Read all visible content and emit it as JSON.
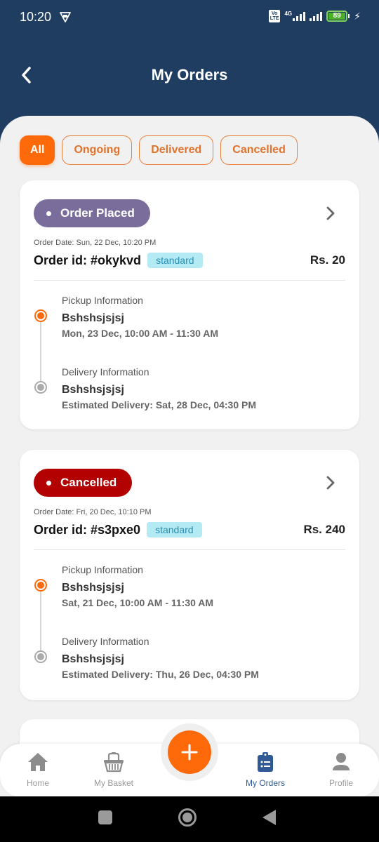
{
  "status_bar": {
    "time": "10:20",
    "network_label": "4G",
    "volte_label": "Vo LTE",
    "battery_percent": "89",
    "icons": [
      "vpn-icon",
      "volte-icon",
      "signal-icon",
      "signal-icon",
      "battery-icon",
      "charging-icon"
    ]
  },
  "header": {
    "title": "My Orders",
    "back_icon": "chevron-left-icon"
  },
  "filters": [
    {
      "label": "All",
      "active": true
    },
    {
      "label": "Ongoing",
      "active": false
    },
    {
      "label": "Delivered",
      "active": false
    },
    {
      "label": "Cancelled",
      "active": false
    }
  ],
  "orders": [
    {
      "status": "Order Placed",
      "status_color": "#7b6d9b",
      "order_date": "Order Date: Sun, 22 Dec, 10:20 PM",
      "order_id": "Order id: #okykvd",
      "tag": "standard",
      "price": "Rs. 20",
      "pickup": {
        "heading": "Pickup Information",
        "name": "Bshshsjsjsj",
        "time": "Mon, 23 Dec, 10:00 AM - 11:30 AM"
      },
      "delivery": {
        "heading": "Delivery Information",
        "name": "Bshshsjsjsj",
        "time": "Estimated Delivery: Sat, 28 Dec, 04:30 PM"
      }
    },
    {
      "status": "Cancelled",
      "status_color": "#b30000",
      "order_date": "Order Date: Fri, 20 Dec, 10:10 PM",
      "order_id": "Order id: #s3pxe0",
      "tag": "standard",
      "price": "Rs. 240",
      "pickup": {
        "heading": "Pickup Information",
        "name": "Bshshsjsjsj",
        "time": "Sat, 21 Dec, 10:00 AM - 11:30 AM"
      },
      "delivery": {
        "heading": "Delivery Information",
        "name": "Bshshsjsjsj",
        "time": "Estimated Delivery: Thu, 26 Dec, 04:30 PM"
      }
    }
  ],
  "bottom_nav": {
    "items": [
      {
        "label": "Home",
        "icon": "home-icon",
        "active": false
      },
      {
        "label": "My Basket",
        "icon": "basket-icon",
        "active": false
      },
      {
        "label": "My Orders",
        "icon": "clipboard-list-icon",
        "active": true
      },
      {
        "label": "Profile",
        "icon": "person-icon",
        "active": false
      }
    ],
    "fab_icon": "plus-icon"
  },
  "colors": {
    "header_bg": "#1f3d60",
    "accent": "#fe6a0a",
    "active_nav": "#2f5a95",
    "tag_bg": "#b4eaf3"
  }
}
